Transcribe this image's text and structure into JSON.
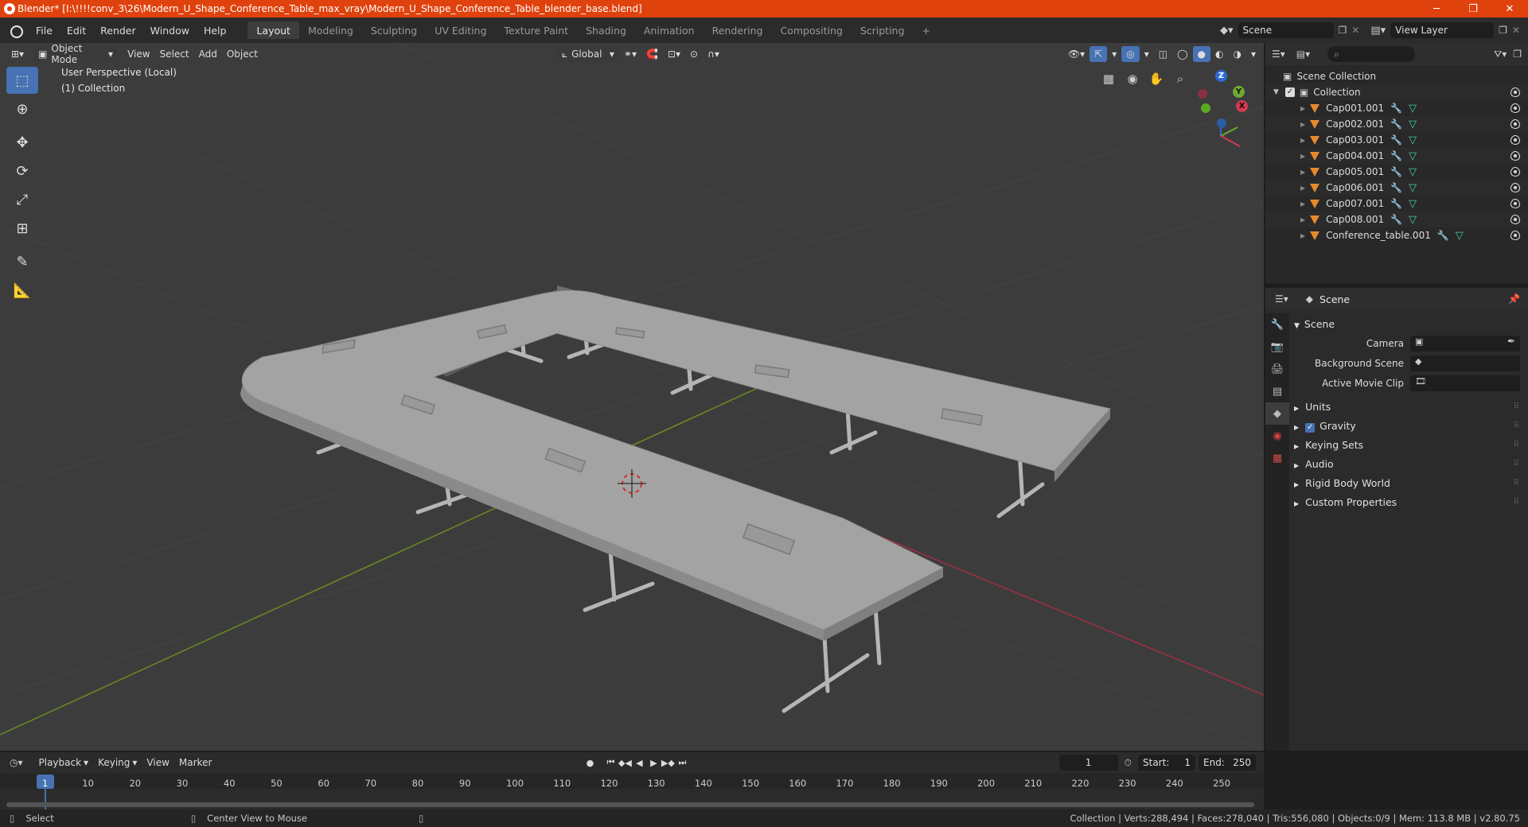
{
  "window": {
    "title": "Blender* [I:\\!!!!conv_3\\26\\Modern_U_Shape_Conference_Table_max_vray\\Modern_U_Shape_Conference_Table_blender_base.blend]",
    "min": "─",
    "max": "❐",
    "close": "✕"
  },
  "menu": [
    "File",
    "Edit",
    "Render",
    "Window",
    "Help"
  ],
  "workspaces": [
    "Layout",
    "Modeling",
    "Sculpting",
    "UV Editing",
    "Texture Paint",
    "Shading",
    "Animation",
    "Rendering",
    "Compositing",
    "Scripting"
  ],
  "workspace_add": "+",
  "scene_field": "Scene",
  "viewlayer_field": "View Layer",
  "viewport_header": {
    "mode": "Object Mode",
    "menus": [
      "View",
      "Select",
      "Add",
      "Object"
    ],
    "orientation": "Global"
  },
  "viewport": {
    "perspective": "User Perspective (Local)",
    "collection": "(1) Collection"
  },
  "gizmo": {
    "x": "X",
    "y": "Y",
    "z": "Z"
  },
  "outliner": {
    "root": "Scene Collection",
    "collection": "Collection",
    "items": [
      "Cap001.001",
      "Cap002.001",
      "Cap003.001",
      "Cap004.001",
      "Cap005.001",
      "Cap006.001",
      "Cap007.001",
      "Cap008.001",
      "Conference_table.001"
    ]
  },
  "properties": {
    "header": "Scene",
    "panel": "Scene",
    "fields": [
      {
        "label": "Camera"
      },
      {
        "label": "Background Scene"
      },
      {
        "label": "Active Movie Clip"
      }
    ],
    "subpanels": [
      "Units",
      "Gravity",
      "Keying Sets",
      "Audio",
      "Rigid Body World",
      "Custom Properties"
    ]
  },
  "timeline": {
    "menus": [
      "Playback",
      "Keying",
      "View",
      "Marker"
    ],
    "current_frame": "1",
    "start_label": "Start:",
    "start": "1",
    "end_label": "End:",
    "end": "250",
    "ticks": [
      "1",
      "10",
      "20",
      "30",
      "40",
      "50",
      "60",
      "70",
      "80",
      "90",
      "100",
      "110",
      "120",
      "130",
      "140",
      "150",
      "160",
      "170",
      "180",
      "190",
      "200",
      "210",
      "220",
      "230",
      "240",
      "250"
    ]
  },
  "status": {
    "left": "Select",
    "middle": "Center View to Mouse",
    "right": "Collection | Verts:288,494 | Faces:278,040 | Tris:556,080 | Objects:0/9 | Mem: 113.8 MB | v2.80.75"
  }
}
